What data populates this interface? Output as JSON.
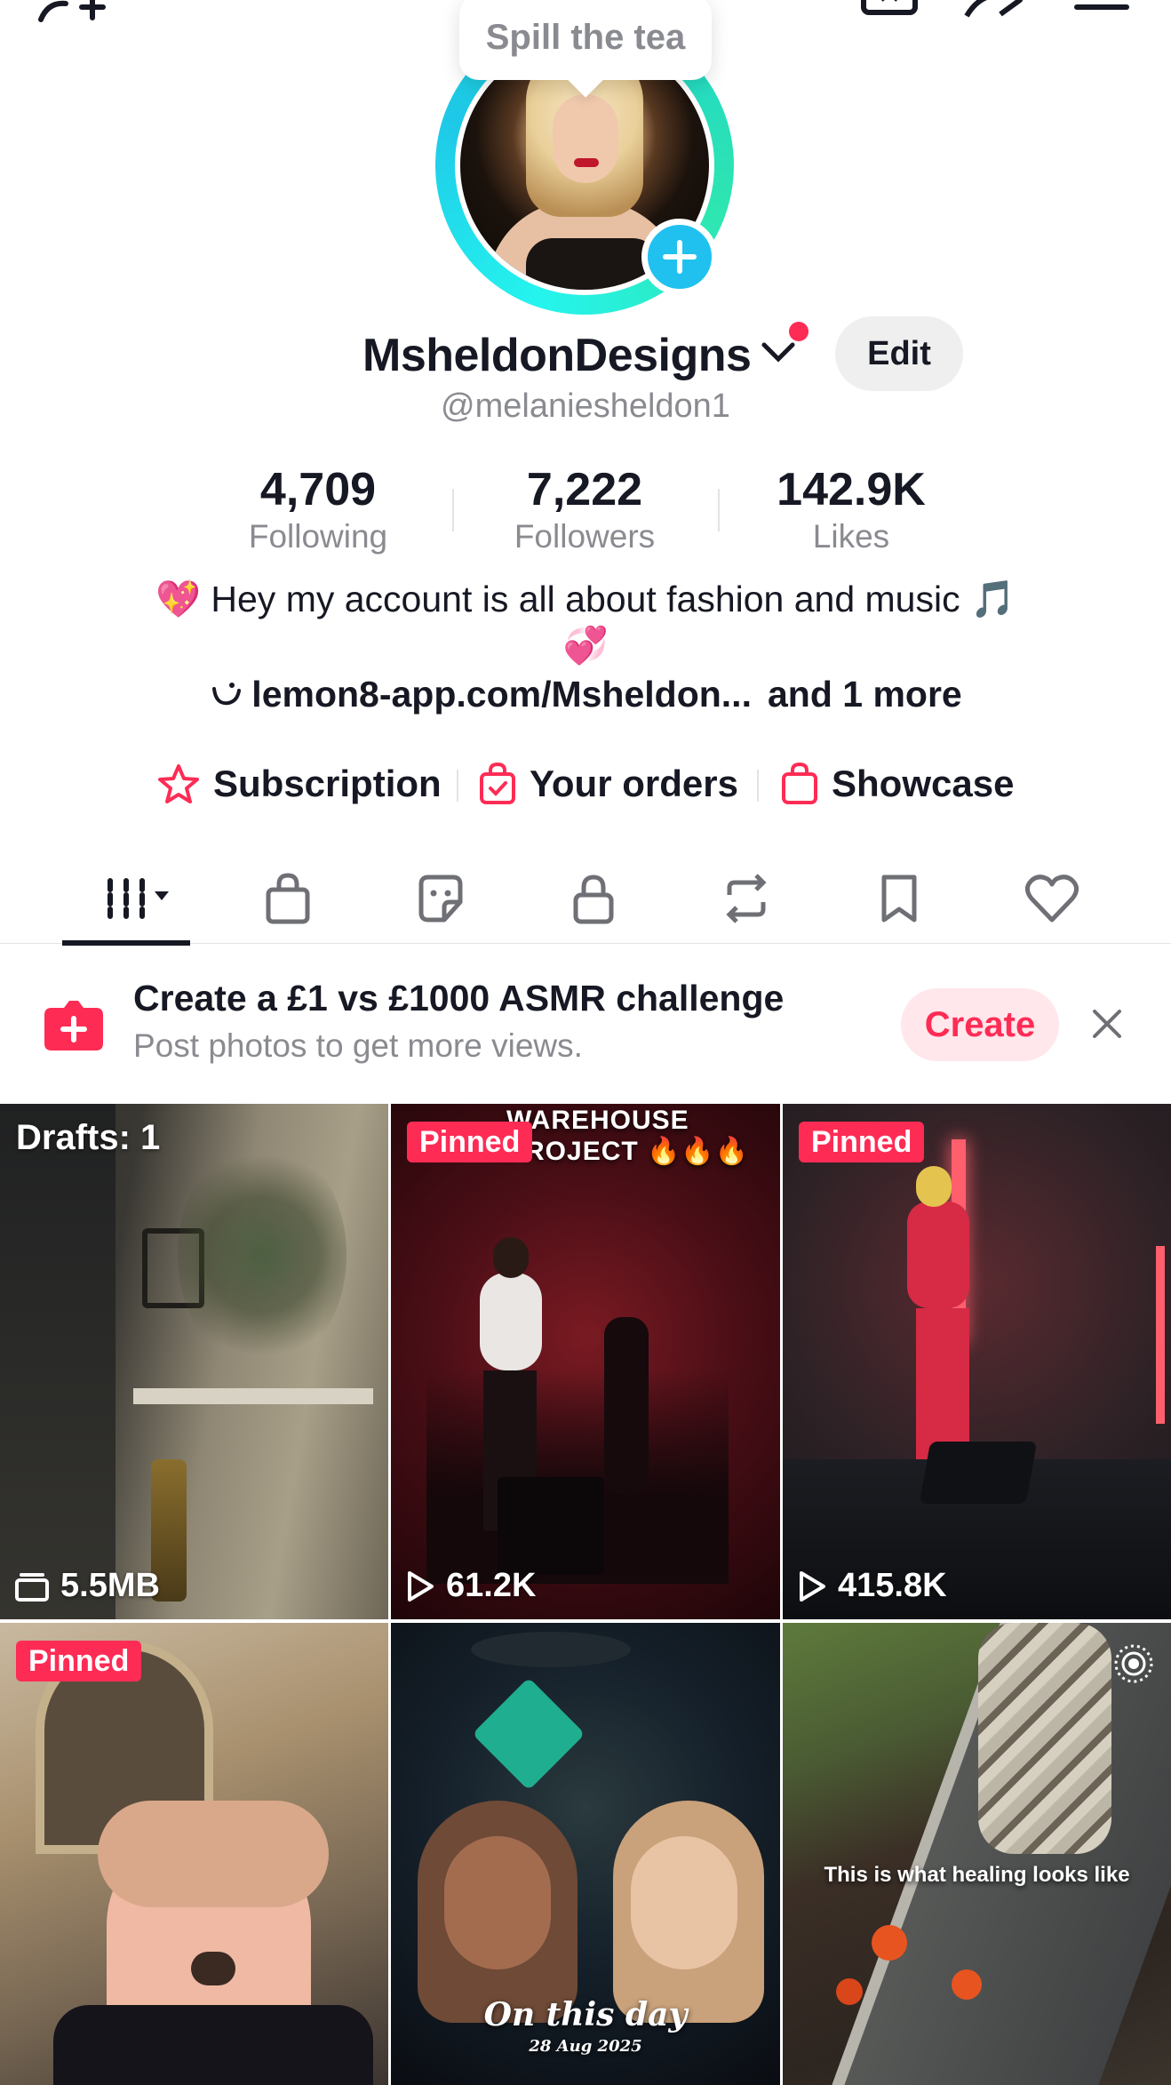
{
  "tooltip": {
    "text": "Spill the tea"
  },
  "profile": {
    "display_name": "MsheldonDesigns",
    "handle": "@melaniesheldon1",
    "edit_label": "Edit"
  },
  "stats": [
    {
      "value": "4,709",
      "label": "Following"
    },
    {
      "value": "7,222",
      "label": "Followers"
    },
    {
      "value": "142.9K",
      "label": "Likes"
    }
  ],
  "bio": {
    "line1": "💖 Hey my account is all about fashion and music 🎵",
    "line2": "💞",
    "link": "lemon8-app.com/Msheldon...",
    "more": "and 1 more"
  },
  "actions": [
    {
      "label": "Subscription",
      "icon": "star-icon"
    },
    {
      "label": "Your orders",
      "icon": "bag-check-icon"
    },
    {
      "label": "Showcase",
      "icon": "shopping-bag-icon"
    }
  ],
  "tabs": [
    "videos-grid-icon",
    "shop-icon",
    "sticker-icon",
    "lock-icon",
    "repost-icon",
    "bookmark-icon",
    "heart-icon"
  ],
  "banner": {
    "title": "Create a £1 vs £1000 ASMR challenge",
    "subtitle": "Post photos to get more views.",
    "create_label": "Create"
  },
  "grid": {
    "drafts_label": "Drafts: 1",
    "drafts_size": "5.5MB",
    "pinned_label": "Pinned",
    "tile2_overlay": "WAREHOUSE PROJECT 🔥🔥🔥",
    "tile2_views": "61.2K",
    "tile3_views": "415.8K",
    "tile5_caption": "On this day",
    "tile5_date": "28 Aug 2025",
    "tile6_caption": "This is what healing looks like"
  },
  "colors": {
    "accent": "#fe2c55",
    "avatar_ring": "#25f4ee",
    "add_badge": "#20c1ef",
    "muted_text": "#8a8b91"
  }
}
